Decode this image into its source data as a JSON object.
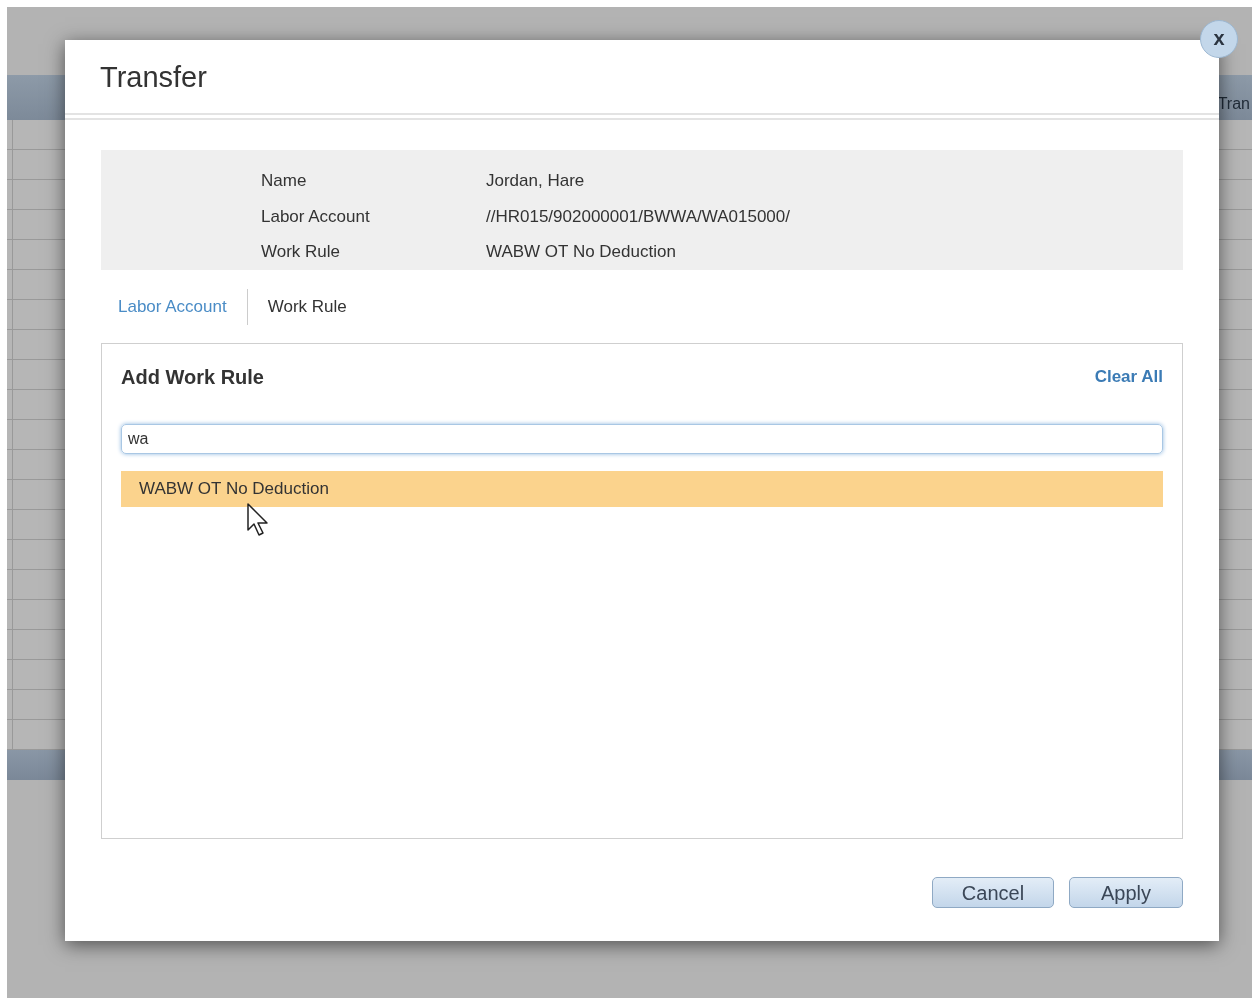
{
  "background": {
    "header_text": "Tran"
  },
  "dialog": {
    "title": "Transfer",
    "close_label": "x",
    "details": [
      {
        "label": "Name",
        "value": "Jordan, Hare"
      },
      {
        "label": "Labor Account",
        "value": "//HR015/902000001/BWWA/WA015000/"
      },
      {
        "label": "Work Rule",
        "value": "WABW OT No Deduction"
      }
    ],
    "tabs": [
      {
        "label": "Labor Account",
        "selected": false
      },
      {
        "label": "Work Rule",
        "selected": true
      }
    ],
    "panel": {
      "title": "Add Work Rule",
      "clear_label": "Clear All",
      "search": {
        "value": "wa"
      },
      "suggestions": [
        {
          "label": "WABW OT No Deduction",
          "selected": true
        }
      ]
    },
    "buttons": [
      {
        "label": "Cancel"
      },
      {
        "label": "Apply"
      }
    ]
  }
}
